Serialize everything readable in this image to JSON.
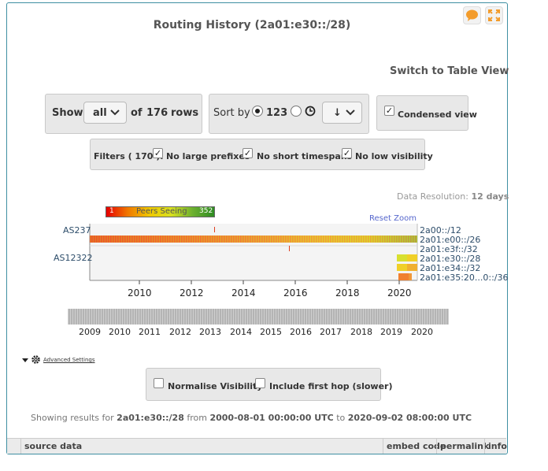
{
  "title": "Routing History (2a01:e30::/28)",
  "switch_view": "Switch to Table View",
  "controls": {
    "show_label": "Show",
    "show_value": "all",
    "of_label": "of",
    "row_count": "176",
    "rows_label": "rows",
    "sort_label": "Sort by",
    "sort_numeric": "123",
    "sort_direction": "↓",
    "condensed_label": "Condensed view",
    "filters_label": "Filters ( 170 ):",
    "filter_large": "No large prefixes",
    "filter_short": "No short timespans",
    "filter_low": "No low visibility"
  },
  "data_resolution_label": "Data Resolution:",
  "data_resolution_value": "12 days",
  "legend": {
    "min": "1",
    "label": "Peers Seeing",
    "max": "352"
  },
  "reset_zoom": "Reset Zoom",
  "as_labels": [
    "AS237",
    "AS12322"
  ],
  "prefixes": [
    "2a00::/12",
    "2a01:e00::/26",
    "2a01:e3f::/32",
    "2a01:e30::/28",
    "2a01:e34::/32",
    "2a01:e35:20...0::/36"
  ],
  "timeline_years": [
    "2010",
    "2012",
    "2014",
    "2016",
    "2018",
    "2020"
  ],
  "brush_years": [
    "2009",
    "2010",
    "2011",
    "2012",
    "2013",
    "2014",
    "2015",
    "2016",
    "2017",
    "2018",
    "2019",
    "2020"
  ],
  "advanced_settings": "Advanced Settings",
  "normalise_visibility": "Normalise Visibility",
  "include_first_hop": "Include first hop (slower)",
  "showing": {
    "prefix_text": "Showing results for",
    "resource": "2a01:e30::/28",
    "from_text": "from",
    "start": "2000-08-01 00:00:00 UTC",
    "to_text": "to",
    "end": "2020-09-02 08:00:00 UTC"
  },
  "footer": {
    "source_data": "source data",
    "embed_code": "embed code",
    "permalink": "permalink",
    "info": "info"
  },
  "colors": {
    "accent": "#f0a030",
    "border": "#3f8fa2",
    "label": "#2d4d6a"
  }
}
